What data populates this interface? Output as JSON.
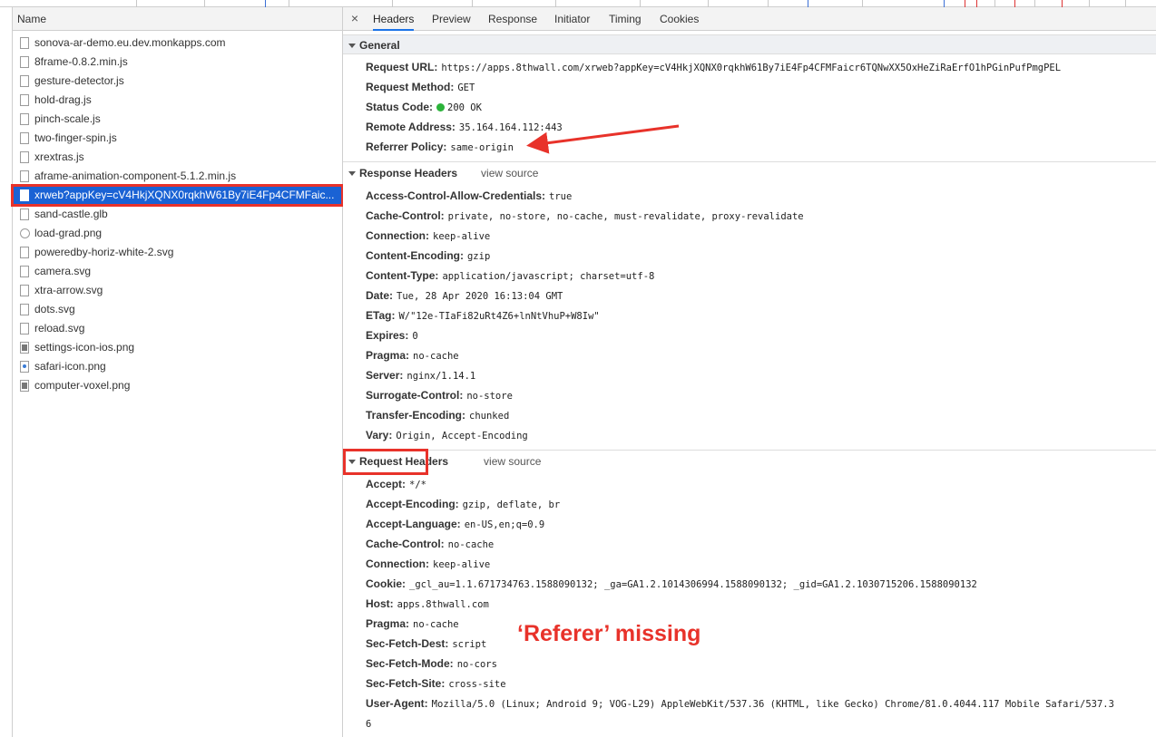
{
  "left_pane": {
    "header": "Name",
    "requests": [
      {
        "name": "sonova-ar-demo.eu.dev.monkapps.com",
        "icon": "document-icon"
      },
      {
        "name": "8frame-0.8.2.min.js",
        "icon": "script-file-icon"
      },
      {
        "name": "gesture-detector.js",
        "icon": "script-file-icon"
      },
      {
        "name": "hold-drag.js",
        "icon": "script-file-icon"
      },
      {
        "name": "pinch-scale.js",
        "icon": "script-file-icon"
      },
      {
        "name": "two-finger-spin.js",
        "icon": "script-file-icon"
      },
      {
        "name": "xrextras.js",
        "icon": "script-file-icon"
      },
      {
        "name": "aframe-animation-component-5.1.2.min.js",
        "icon": "script-file-icon"
      },
      {
        "name": "xrweb?appKey=cV4HkjXQNX0rqkhW61By7iE4Fp4CFMFaic...",
        "icon": "script-file-icon",
        "selected": true
      },
      {
        "name": "sand-castle.glb",
        "icon": "file-icon"
      },
      {
        "name": "load-grad.png",
        "icon": "image-file-icon"
      },
      {
        "name": "poweredby-horiz-white-2.svg",
        "icon": "file-icon"
      },
      {
        "name": "camera.svg",
        "icon": "file-icon"
      },
      {
        "name": "xtra-arrow.svg",
        "icon": "file-icon"
      },
      {
        "name": "dots.svg",
        "icon": "file-icon"
      },
      {
        "name": "reload.svg",
        "icon": "file-icon"
      },
      {
        "name": "settings-icon-ios.png",
        "icon": "image-file-icon"
      },
      {
        "name": "safari-icon.png",
        "icon": "image-file-icon"
      },
      {
        "name": "computer-voxel.png",
        "icon": "image-file-icon"
      }
    ]
  },
  "tabs": [
    "Headers",
    "Preview",
    "Response",
    "Initiator",
    "Timing",
    "Cookies"
  ],
  "active_tab": "Headers",
  "general": {
    "title": "General",
    "rows": [
      {
        "key": "Request URL:",
        "value": "https://apps.8thwall.com/xrweb?appKey=cV4HkjXQNX0rqkhW61By7iE4Fp4CFMFaicr6TQNwXX5OxHeZiRaErfO1hPGinPufPmgPEL"
      },
      {
        "key": "Request Method:",
        "value": "GET"
      },
      {
        "key": "Status Code:",
        "value": "200 OK"
      },
      {
        "key": "Remote Address:",
        "value": "35.164.164.112:443"
      },
      {
        "key": "Referrer Policy:",
        "value": "same-origin"
      }
    ]
  },
  "response_headers": {
    "title": "Response Headers",
    "view_source": "view source",
    "rows": [
      {
        "key": "Access-Control-Allow-Credentials:",
        "value": "true"
      },
      {
        "key": "Cache-Control:",
        "value": "private, no-store, no-cache, must-revalidate, proxy-revalidate"
      },
      {
        "key": "Connection:",
        "value": "keep-alive"
      },
      {
        "key": "Content-Encoding:",
        "value": "gzip"
      },
      {
        "key": "Content-Type:",
        "value": "application/javascript; charset=utf-8"
      },
      {
        "key": "Date:",
        "value": "Tue, 28 Apr 2020 16:13:04 GMT"
      },
      {
        "key": "ETag:",
        "value": "W/\"12e-TIaFi82uRt4Z6+lnNtVhuP+W8Iw\""
      },
      {
        "key": "Expires:",
        "value": "0"
      },
      {
        "key": "Pragma:",
        "value": "no-cache"
      },
      {
        "key": "Server:",
        "value": "nginx/1.14.1"
      },
      {
        "key": "Surrogate-Control:",
        "value": "no-store"
      },
      {
        "key": "Transfer-Encoding:",
        "value": "chunked"
      },
      {
        "key": "Vary:",
        "value": "Origin, Accept-Encoding"
      }
    ]
  },
  "request_headers": {
    "title": "Request Headers",
    "view_source": "view source",
    "rows": [
      {
        "key": "Accept:",
        "value": "*/*"
      },
      {
        "key": "Accept-Encoding:",
        "value": "gzip, deflate, br"
      },
      {
        "key": "Accept-Language:",
        "value": "en-US,en;q=0.9"
      },
      {
        "key": "Cache-Control:",
        "value": "no-cache"
      },
      {
        "key": "Connection:",
        "value": "keep-alive"
      },
      {
        "key": "Cookie:",
        "value": "_gcl_au=1.1.671734763.1588090132; _ga=GA1.2.1014306994.1588090132; _gid=GA1.2.1030715206.1588090132"
      },
      {
        "key": "Host:",
        "value": "apps.8thwall.com"
      },
      {
        "key": "Pragma:",
        "value": "no-cache"
      },
      {
        "key": "Sec-Fetch-Dest:",
        "value": "script"
      },
      {
        "key": "Sec-Fetch-Mode:",
        "value": "no-cors"
      },
      {
        "key": "Sec-Fetch-Site:",
        "value": "cross-site"
      },
      {
        "key": "User-Agent:",
        "value": "Mozilla/5.0 (Linux; Android 9; VOG-L29) AppleWebKit/537.36 (KHTML, like Gecko) Chrome/81.0.4044.117 Mobile Safari/537.3"
      }
    ],
    "user_agent_wrap": "6"
  },
  "annotation": {
    "text": "‘Referer’ missing",
    "color": "#e8322a"
  },
  "colors": {
    "selection": "#1a62d4",
    "annotation_red": "#e8322a",
    "status_green": "#2bb33a"
  }
}
